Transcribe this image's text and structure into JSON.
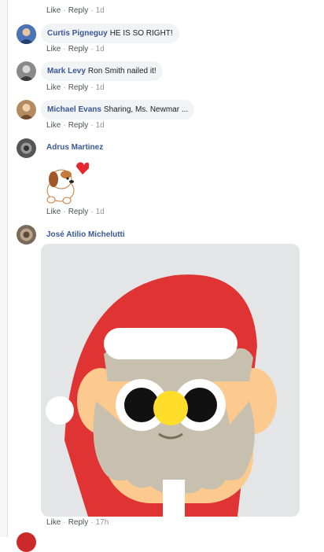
{
  "actions": {
    "like": "Like",
    "reply": "Reply",
    "separator": "·"
  },
  "top_meta": {
    "time": "1d"
  },
  "comments": [
    {
      "name": "Curtis Pigneguy",
      "text": "HE IS SO RIGHT!",
      "time": "1d"
    },
    {
      "name": "Mark Levy",
      "text": "Ron Smith nailed it!",
      "time": "1d"
    },
    {
      "name": "Michael Evans",
      "text": "Sharing, Ms. Newmar ...",
      "time": "1d"
    },
    {
      "name": "Adrus Martinez",
      "text": "",
      "time": "1d",
      "attachment": "puppy-heart-sticker"
    },
    {
      "name": "José Atilio Michelutti",
      "text": "",
      "time": "17h",
      "attachment": "santa-owl-sticker"
    }
  ],
  "colors": {
    "link": "#385898",
    "bubble": "#f2f3f5",
    "meta": "#90949c",
    "santa_red": "#e03434",
    "beard": "#c8c0ae",
    "beak": "#ffdd2b"
  }
}
